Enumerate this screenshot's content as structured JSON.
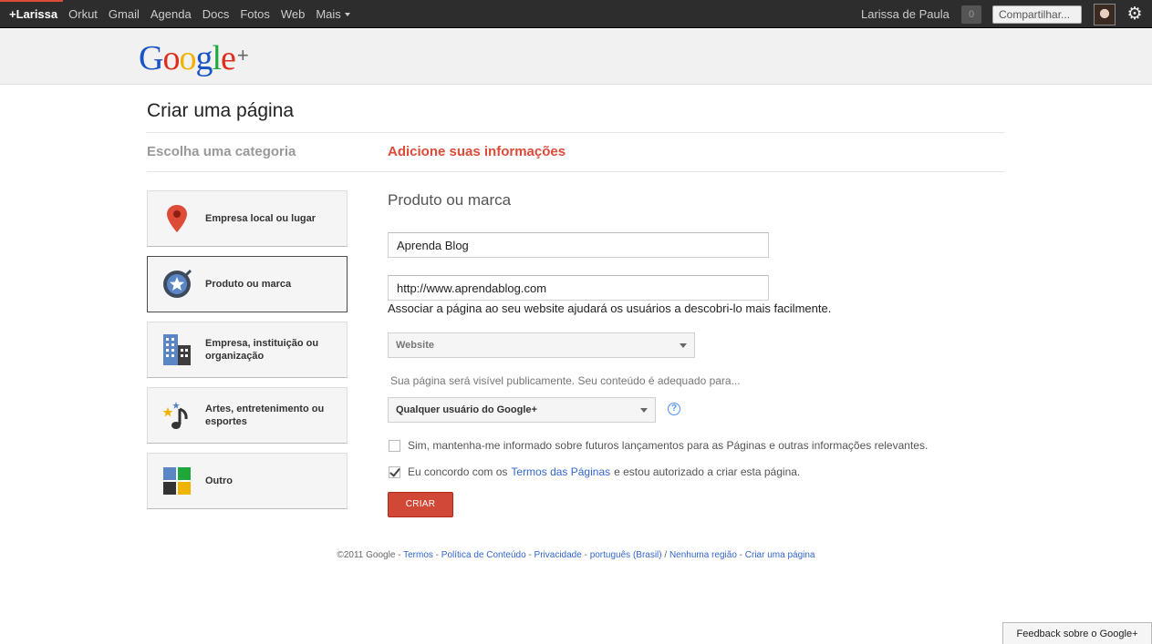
{
  "topbar": {
    "nav": [
      {
        "label": "+Larissa",
        "active": true
      },
      {
        "label": "Orkut"
      },
      {
        "label": "Gmail"
      },
      {
        "label": "Agenda"
      },
      {
        "label": "Docs"
      },
      {
        "label": "Fotos"
      },
      {
        "label": "Web"
      },
      {
        "label": "Mais"
      }
    ],
    "user_name": "Larissa de Paula",
    "notification_count": "0",
    "share_label": "Compartilhar..."
  },
  "header": {
    "logo_letters": [
      "G",
      "o",
      "o",
      "g",
      "l",
      "e"
    ],
    "logo_colors": [
      "#1a53c4",
      "#dd2e1e",
      "#f0b400",
      "#1a53c4",
      "#1ea83a",
      "#dd2e1e"
    ],
    "logo_plus": "+"
  },
  "page": {
    "title": "Criar uma página",
    "step1": "Escolha uma categoria",
    "step2": "Adicione suas informações"
  },
  "categories": [
    {
      "label": "Empresa local ou lugar",
      "icon": "map-pin-icon"
    },
    {
      "label": "Produto ou marca",
      "icon": "badge-star-icon",
      "selected": true
    },
    {
      "label": "Empresa, instituição ou organização",
      "icon": "building-icon"
    },
    {
      "label": "Artes, entretenimento ou esportes",
      "icon": "music-note-icon"
    },
    {
      "label": "Outro",
      "icon": "other-squares-icon"
    }
  ],
  "form": {
    "section_title": "Produto ou marca",
    "name_value": "Aprenda Blog",
    "website_value": "http://www.aprendablog.com",
    "website_hint": "Associar a página ao seu website ajudará os usuários a descobri-lo mais facilmente.",
    "category_select": "Website",
    "visibility_hint": "Sua página será visível publicamente. Seu conteúdo é adequado para...",
    "audience_select": "Qualquer usuário do Google+",
    "help_label": "?",
    "checkbox_updates": "Sim, mantenha-me informado sobre futuros lançamentos para as Páginas e outras informações relevantes.",
    "checkbox_terms_pre": "Eu concordo com os",
    "checkbox_terms_link": "Termos das Páginas",
    "checkbox_terms_post": "e estou autorizado a criar esta página.",
    "create_button": "CRIAR"
  },
  "footer": {
    "copyright": "©2011 Google -",
    "links": [
      "Termos",
      "Política de Conteúdo",
      "Privacidade",
      "português (Brasil)",
      "Nenhuma região",
      "Criar uma página"
    ],
    "separators": [
      " - ",
      " - ",
      " - ",
      " / ",
      " - "
    ]
  },
  "feedback_label": "Feedback sobre o Google+",
  "colors": {
    "accent_red": "#dd4b39",
    "button_red": "#d14836",
    "link_blue": "#3366cc",
    "topbar_bg": "#2d2d2d"
  }
}
